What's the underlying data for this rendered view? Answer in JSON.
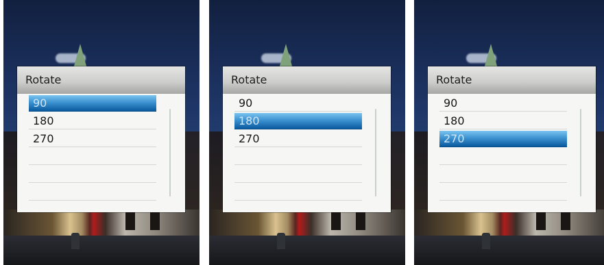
{
  "screens": [
    {
      "dialog": {
        "title": "Rotate",
        "options": [
          "90",
          "180",
          "270"
        ],
        "selected": "90"
      }
    },
    {
      "dialog": {
        "title": "Rotate",
        "options": [
          "90",
          "180",
          "270"
        ],
        "selected": "180"
      }
    },
    {
      "dialog": {
        "title": "Rotate",
        "options": [
          "90",
          "180",
          "270"
        ],
        "selected": "270"
      }
    }
  ],
  "colors": {
    "selection_top": "#7bc4ef",
    "selection_bottom": "#0a5a9e",
    "dialog_body": "#f6f7f5",
    "header_gradient": [
      "#e5e5e3",
      "#a6a6a4"
    ]
  }
}
